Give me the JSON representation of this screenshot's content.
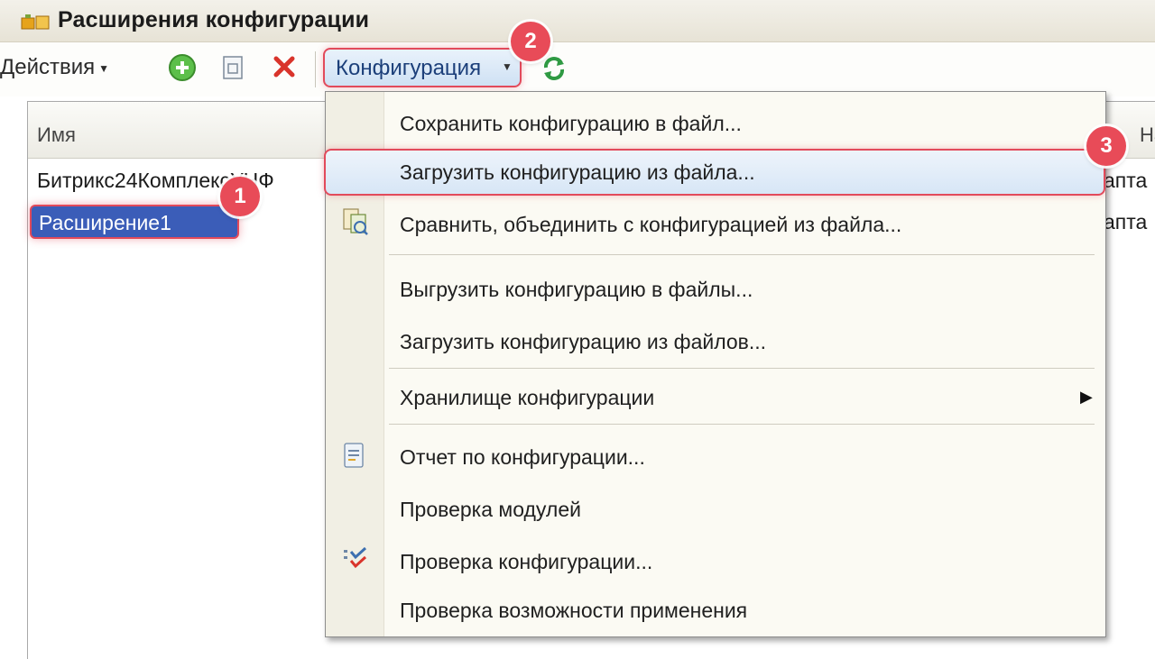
{
  "window": {
    "title": "Расширения конфигурации"
  },
  "toolbar": {
    "actions_label": "Действия",
    "config_label": "Конфигурация"
  },
  "list": {
    "column_name": "Имя",
    "column_right": "Наз",
    "rows": [
      {
        "name": "Битрикс24КомплексУНФ",
        "extra": "апта"
      },
      {
        "name": "Расширение1",
        "extra": "апта"
      }
    ]
  },
  "menu": {
    "items": [
      {
        "label": "Сохранить конфигурацию в файл..."
      },
      {
        "label": "Загрузить конфигурацию из файла..."
      },
      {
        "label": "Сравнить, объединить с конфигурацией из файла..."
      },
      {
        "label": "Выгрузить конфигурацию в файлы..."
      },
      {
        "label": "Загрузить конфигурацию из файлов..."
      },
      {
        "label": "Хранилище конфигурации"
      },
      {
        "label": "Отчет по конфигурации..."
      },
      {
        "label": "Проверка модулей"
      },
      {
        "label": "Проверка конфигурации..."
      },
      {
        "label": "Проверка возможности применения"
      }
    ]
  },
  "badges": {
    "step1": "1",
    "step2": "2",
    "step3": "3"
  },
  "colors": {
    "highlight_border": "#e24a5b",
    "badge": "#e84b58",
    "selection": "#3b5db8"
  }
}
